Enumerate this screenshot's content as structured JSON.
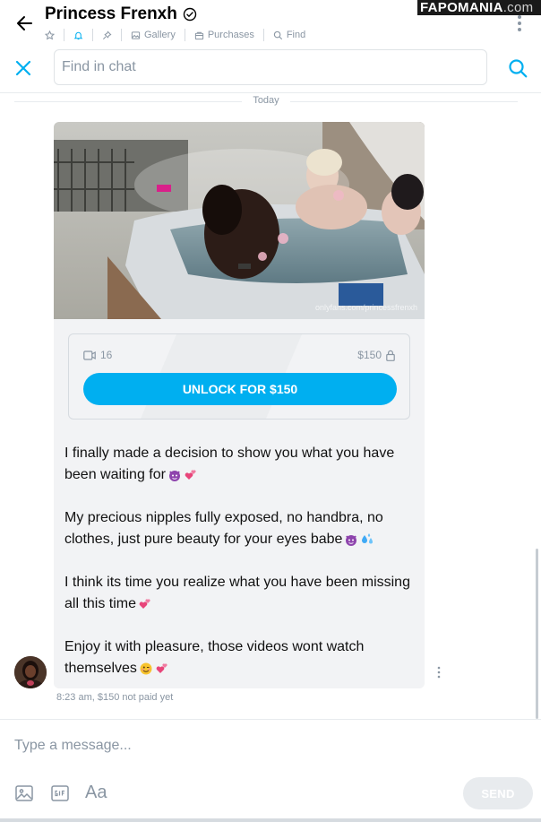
{
  "header": {
    "title": "Princess Frenxh",
    "toolbar": {
      "gallery_label": "Gallery",
      "purchases_label": "Purchases",
      "find_label": "Find"
    }
  },
  "watermark": {
    "part1": "FAP",
    "part2": "OMANIA",
    "part3": ".com"
  },
  "search": {
    "placeholder": "Find in chat"
  },
  "chat": {
    "date_separator": "Today",
    "message": {
      "media_credit": "onlyfans.com/princessfrenxh",
      "media_count": "16",
      "price": "$150",
      "unlock_label": "UNLOCK FOR $150",
      "paragraphs": [
        "I finally made a decision to show you what you have been waiting for",
        "My precious nipples fully exposed, no handbra, no clothes, just pure beauty for your eyes babe",
        "I think its time you realize what you have been missing all this time",
        "Enjoy it with pleasure, those videos wont watch themselves"
      ],
      "time": "8:23 am,",
      "payment_status": "$150 not paid yet"
    }
  },
  "composer": {
    "placeholder": "Type a message...",
    "font_label": "Aa",
    "send_label": "SEND"
  },
  "colors": {
    "accent": "#00aff0",
    "muted": "#8a96a3",
    "bubble": "#f2f3f5"
  }
}
